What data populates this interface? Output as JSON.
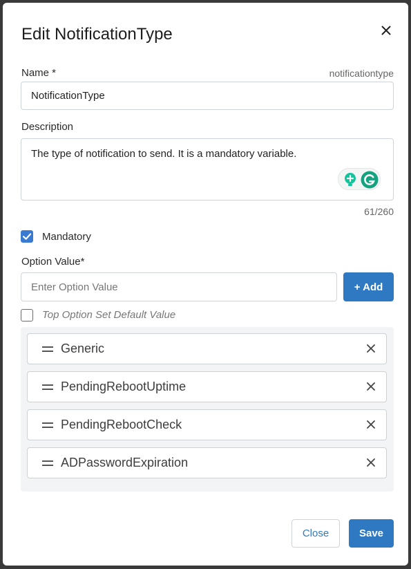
{
  "dialog": {
    "title": "Edit NotificationType",
    "close_icon": "close-icon"
  },
  "name_field": {
    "label": "Name *",
    "slug": "notificationtype",
    "value": "NotificationType"
  },
  "description_field": {
    "label": "Description",
    "value": "The type of notification to send. It is a mandatory variable.",
    "counter": "61/260",
    "extension_icons": [
      "grammarly-bulb-icon",
      "grammarly-icon"
    ]
  },
  "mandatory": {
    "checked": true,
    "label": "Mandatory"
  },
  "option_value": {
    "label": "Option Value*",
    "placeholder": "Enter Option Value",
    "add_button": "+ Add"
  },
  "top_default": {
    "checked": false,
    "label": "Top Option Set Default Value"
  },
  "options": [
    {
      "label": "Generic"
    },
    {
      "label": "PendingRebootUptime"
    },
    {
      "label": "PendingRebootCheck"
    },
    {
      "label": "ADPasswordExpiration"
    }
  ],
  "footer": {
    "close_button": "Close",
    "save_button": "Save"
  },
  "colors": {
    "primary": "#2f79c2",
    "checkbox": "#3a7ad1",
    "grammarly_green": "#15c39a"
  }
}
